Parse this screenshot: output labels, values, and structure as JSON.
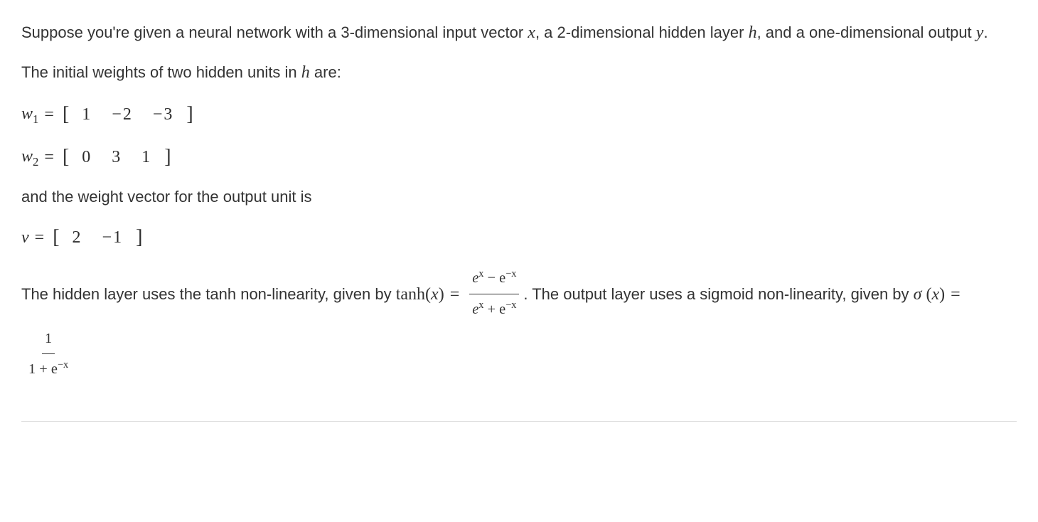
{
  "para1_a": "Suppose you're given a neural network with a 3-dimensional input vector ",
  "para1_b": ", a 2-dimensional hidden layer ",
  "para1_c": ", and a one-dimensional output ",
  "para1_d": ".",
  "var_x": "x",
  "var_h": "h",
  "var_y": "y",
  "para2_a": "The initial weights of two hidden units in ",
  "para2_b": " are:",
  "w1_label": "w",
  "w1_sub": "1",
  "w1_vals": [
    "1",
    "−2",
    "−3"
  ],
  "w2_label": "w",
  "w2_sub": "2",
  "w2_vals": [
    "0",
    "3",
    "1"
  ],
  "para3": "and the weight vector for the output unit is",
  "v_label": "v",
  "v_vals": [
    "2",
    "−1"
  ],
  "para4_a": "The hidden layer uses the tanh non-linearity, given by ",
  "tanh_label": "tanh",
  "para4_b": ". The output layer uses a sigmoid non-linearity, given by ",
  "sigma_label": "σ",
  "open_paren": "(",
  "close_paren": ")",
  "equals": "=",
  "tanh_num_a": "e",
  "tanh_num_b": " − e",
  "tanh_denom_a": "e",
  "tanh_denom_b": " + e",
  "sup_x": "x",
  "sup_negx": "−x",
  "sig_num": "1",
  "sig_denom_a": "1 + e",
  "lbracket": "[",
  "rbracket": "]"
}
